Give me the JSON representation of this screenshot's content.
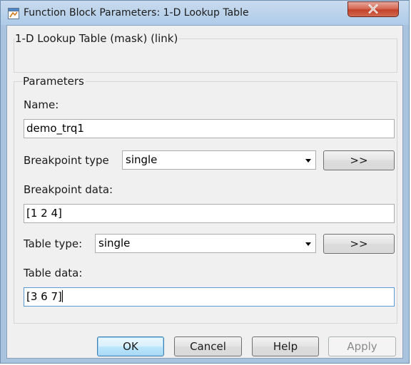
{
  "window": {
    "title": "Function Block Parameters: 1-D Lookup Table",
    "close_glyph": "X"
  },
  "mask": {
    "heading": "1-D Lookup Table (mask) (link)"
  },
  "parameters": {
    "heading": "Parameters",
    "name_label": "Name:",
    "name_value": "demo_trq1",
    "breakpoint_type_label": "Breakpoint type",
    "breakpoint_type_value": "single",
    "breakpoint_type_button": ">>",
    "breakpoint_data_label": "Breakpoint data:",
    "breakpoint_data_value": "[1 2 4]",
    "table_type_label": "Table type:",
    "table_type_value": "single",
    "table_type_button": ">>",
    "table_data_label": "Table data:",
    "table_data_value": "[3 6 7]"
  },
  "buttons": {
    "ok": "OK",
    "cancel": "Cancel",
    "help": "Help",
    "apply": "Apply"
  },
  "colors": {
    "titlebar": "#aecbe8",
    "close_button": "#c4412a",
    "dialog_background": "#f0f0f0",
    "focused_border": "#5b9bd5"
  }
}
